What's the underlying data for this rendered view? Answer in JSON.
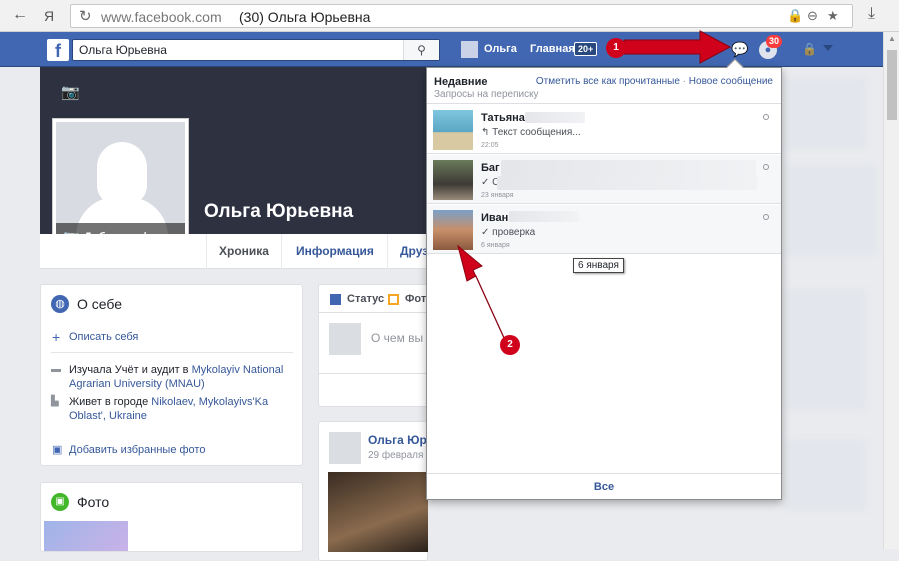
{
  "browser": {
    "back": "←",
    "site_icon": "Я",
    "url": "www.facebook.com",
    "page_title": "(30) Ольга Юрьевна",
    "download": "⤓"
  },
  "fbbar": {
    "logo": "f",
    "search_value": "Ольга Юрьевна",
    "user_name": "Ольга",
    "home_label": "Главная",
    "home_count": "20+",
    "notif_count": "30"
  },
  "profile": {
    "name": "Ольга Юрьевна",
    "add_photo": "Добавить фото",
    "tabs": [
      "Хроника",
      "Информация",
      "Друз"
    ]
  },
  "about": {
    "title": "О себе",
    "describe_link": "Описать себя",
    "studied_prefix": "Изучала Учёт и аудит в ",
    "studied_link": "Mykolayiv National Agrarian University (MNAU)",
    "lives_prefix": "Живет в городе ",
    "lives_link": "Nikolaev, Mykolayivs'Ka Oblast', Ukraine",
    "add_photos_link": "Добавить избранные фото"
  },
  "photos": {
    "title": "Фото"
  },
  "composer": {
    "status_tab": "Статус",
    "photo_tab": "Фото",
    "placeholder": "О чем вы"
  },
  "post": {
    "author": "Ольга Юр",
    "date": "29 февраля"
  },
  "messages_dropdown": {
    "recent": "Недавние",
    "requests": "Запросы на переписку",
    "mark_all_read": "Отметить все как прочитанные",
    "separator": "·",
    "new_message": "Новое сообщение",
    "threads": [
      {
        "name": "Татьяна",
        "snippet": "↰ Текст сообщения...",
        "time": "22:05"
      },
      {
        "name": "Баг",
        "snippet": "✓ С",
        "time": "23 января"
      },
      {
        "name": "Иван",
        "snippet": "✓ проверка",
        "time": "6 января"
      }
    ],
    "tooltip": "6 января",
    "see_all": "Все"
  },
  "annotations": {
    "one": "1",
    "two": "2"
  },
  "colors": {
    "fb_blue": "#4267b2",
    "annotation_red": "#d0021b"
  }
}
